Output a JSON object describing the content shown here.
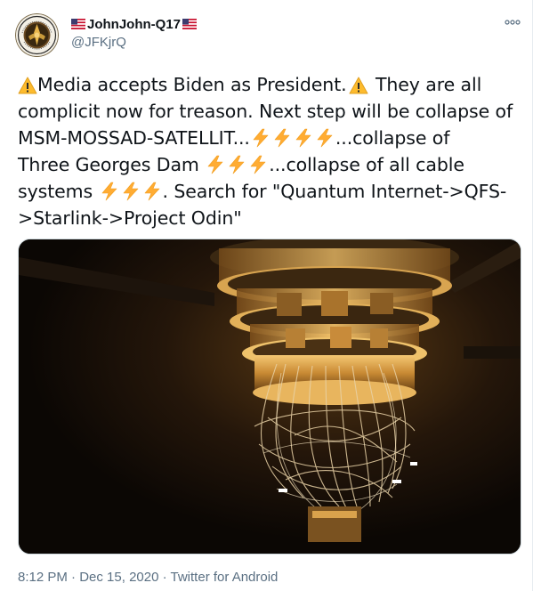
{
  "author": {
    "display_name": "JohnJohn-Q17",
    "handle": "@JFKjrQ",
    "avatar_icon": "seal-avatar-icon",
    "flag_icon": "us-flag-icon"
  },
  "more_icon": "more-options-icon",
  "tweet": {
    "lines": [
      {
        "pre": "",
        "warn1": true,
        "text1": "Media accepts Biden as President.",
        "warn2": true,
        "text2": " They are all"
      },
      {
        "text": "complicit now for treason. Next step will be collapse of"
      },
      {
        "text": "MSM-MOSSAD-SATELLIT...",
        "bolts": 4,
        "after": "...collapse of"
      },
      {
        "text": "Three Georges Dam ",
        "bolts": 3,
        "after": "...collapse of all cable"
      },
      {
        "text": "systems ",
        "bolts": 3,
        "after": ". Search for \"Quantum Internet->QFS-"
      },
      {
        "text": ">Starlink->Project Odin\""
      }
    ]
  },
  "line1_text1": "Media accepts Biden as President.",
  "line1_text2": " They are all",
  "line2": "complicit now for treason. Next step will be collapse of",
  "line3_text": "MSM-MOSSAD-SATELLIT...",
  "line3_after": "...collapse of",
  "line4_text": "Three Georges Dam ",
  "line4_after": "...collapse of all cable",
  "line5_text": "systems ",
  "line5_after": ". Search for \"Quantum Internet->QFS-",
  "line6": ">Starlink->Project Odin\"",
  "media": {
    "alt_icon": "quantum-computer-photo"
  },
  "footer": {
    "time": "8:12 PM",
    "sep1": " · ",
    "date": "Dec 15, 2020",
    "sep2": " · ",
    "source": "Twitter for Android"
  },
  "colors": {
    "text": "#0f1419",
    "muted": "#5b7083",
    "border": "#cfd9de",
    "warning": "#fdbb2d",
    "bolt": "#ffac33"
  }
}
